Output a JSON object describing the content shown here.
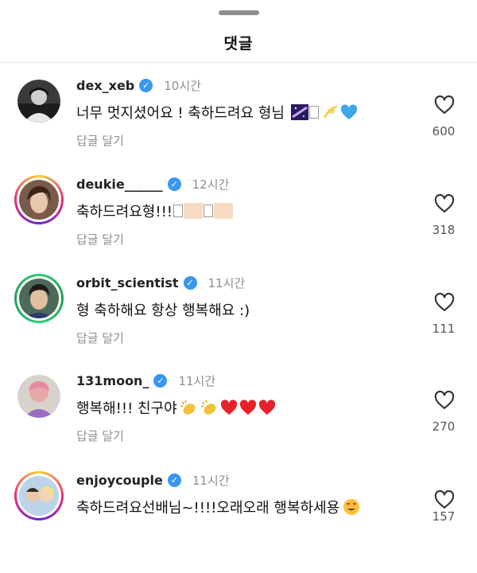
{
  "header": {
    "title": "댓글"
  },
  "labels": {
    "reply": "답글 달기"
  },
  "comments": [
    {
      "username": "dex_xeb",
      "time": "10시간",
      "text": "너무 멋지셨어요 ! 축하드려요 형님",
      "likes": "600",
      "emoji": [
        "galaxy",
        "tofu",
        "dizzy",
        "blue-heart"
      ]
    },
    {
      "username": "deukie______",
      "time": "12시간",
      "text": "축하드려요형!!!",
      "likes": "318",
      "emoji": [
        "tofu",
        "skin",
        "tofu",
        "skin"
      ]
    },
    {
      "username": "orbit_scientist",
      "time": "11시간",
      "text": "형 축하해요 항상 행복해요 :)",
      "likes": "111",
      "emoji": []
    },
    {
      "username": "131moon_",
      "time": "11시간",
      "text": "행복해!!! 친구야",
      "likes": "270",
      "emoji": [
        "clap",
        "clap",
        "red-heart",
        "red-heart",
        "red-heart"
      ]
    },
    {
      "username": "enjoycouple",
      "time": "11시간",
      "text": "축하드려요선배님~!!!!오래오래 행복하세용",
      "likes": "157",
      "emoji": [
        "heart-eyes"
      ]
    }
  ],
  "icons": {
    "verified": "verified-badge-icon",
    "like": "heart-outline-icon"
  },
  "colors": {
    "verified": "#3897f0",
    "muted": "#8e8e8e",
    "divider": "#e6e6e6"
  }
}
